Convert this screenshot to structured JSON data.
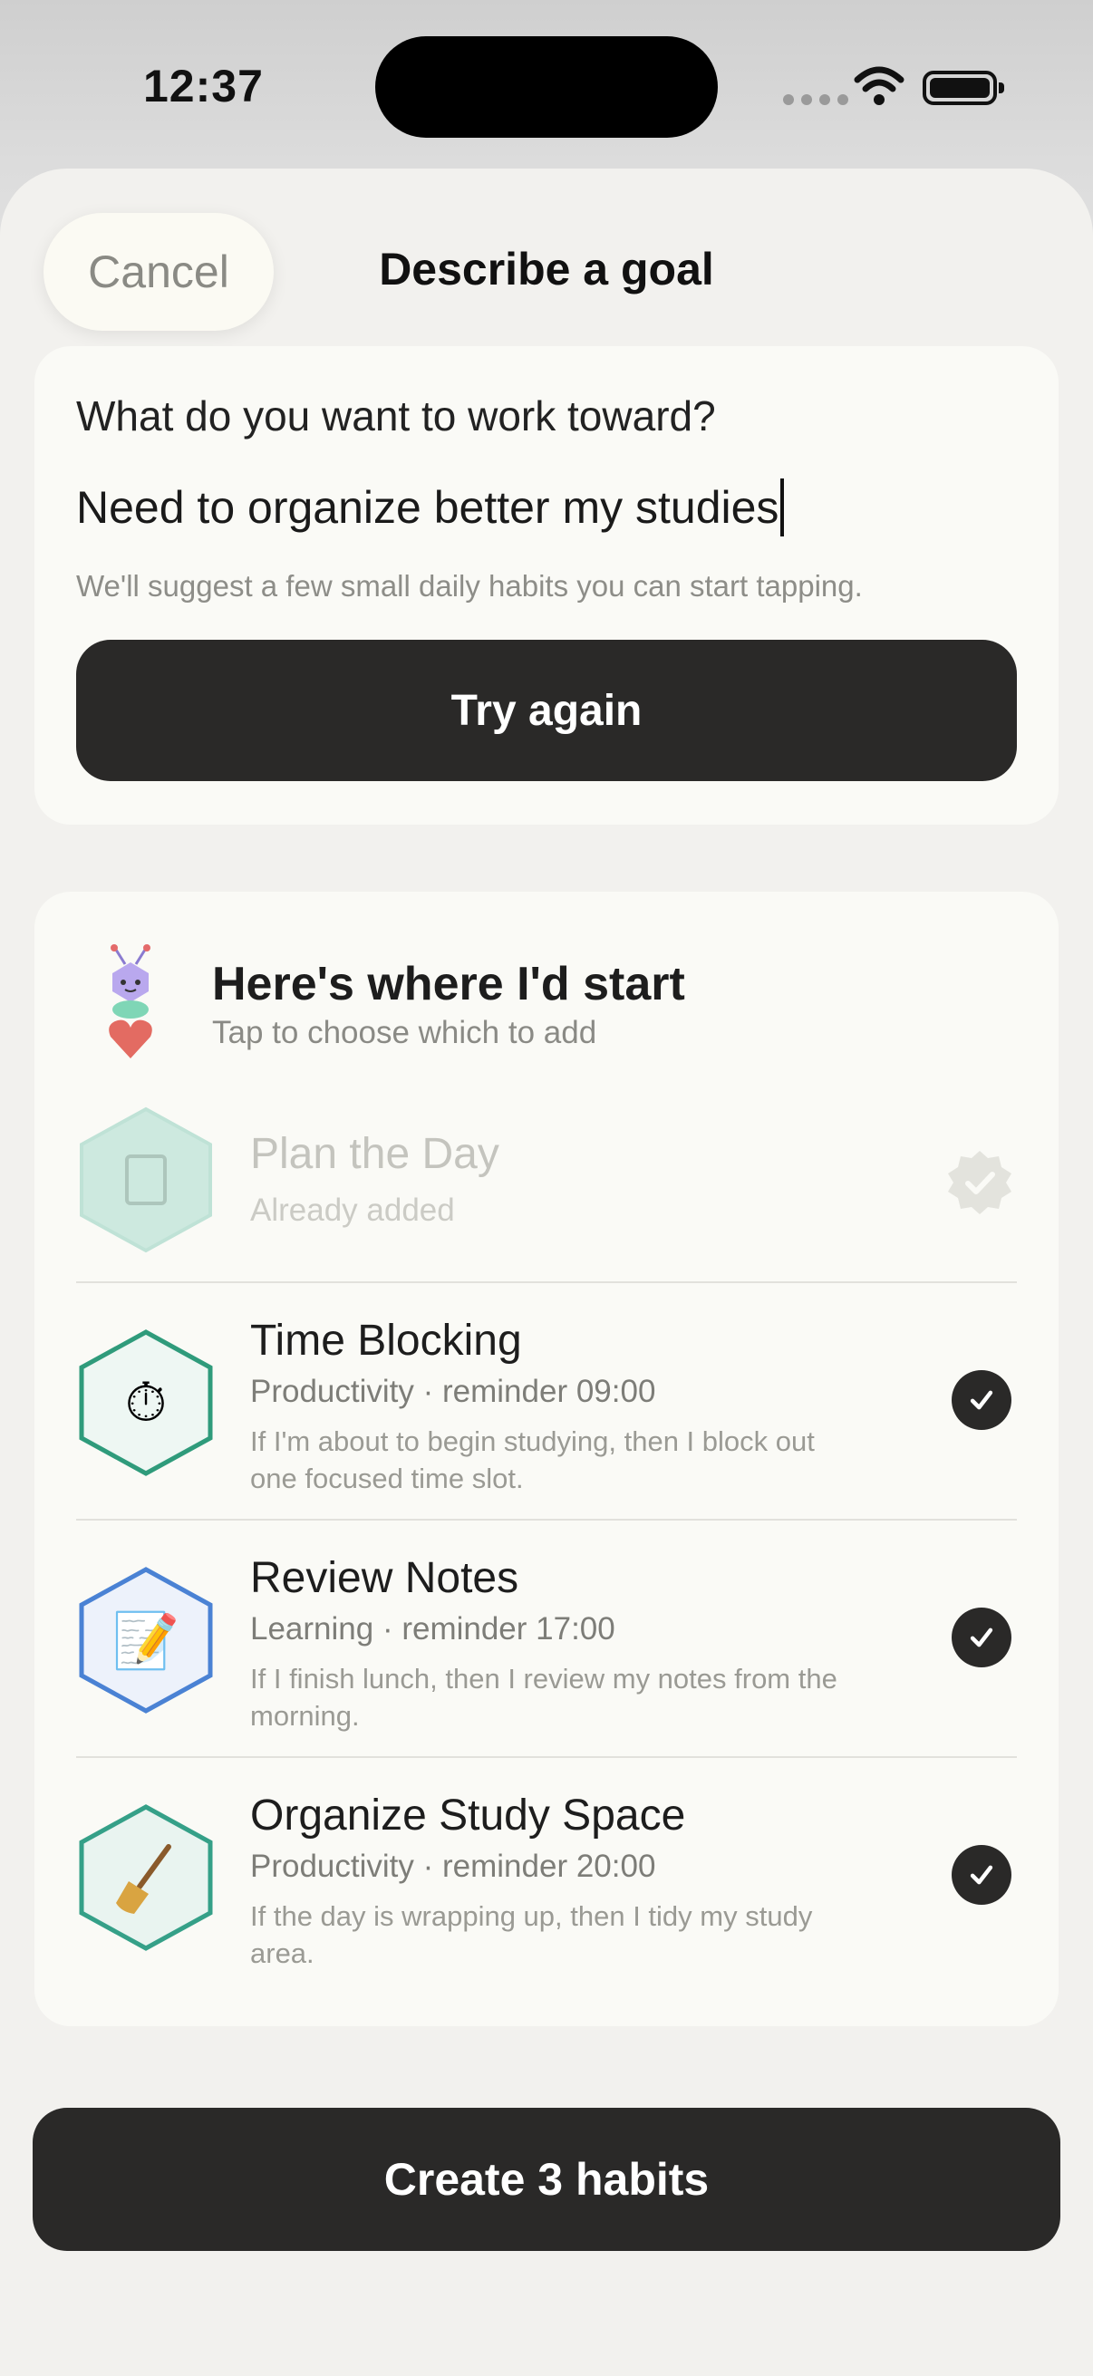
{
  "status_bar": {
    "time": "12:37"
  },
  "header": {
    "cancel_label": "Cancel",
    "title": "Describe a goal"
  },
  "goal": {
    "prompt": "What do you want to work toward?",
    "input_value": "Need to organize better my studies",
    "hint": "We'll suggest a few small daily habits you can start tapping.",
    "try_again_label": "Try again"
  },
  "suggestions": {
    "title": "Here's where I'd start",
    "subtitle": "Tap to choose which to add",
    "items": [
      {
        "name": "Plan the Day",
        "meta": "Already added",
        "desc": "",
        "icon": "notepad-icon",
        "status": "added",
        "color": "#7ccfb5"
      },
      {
        "name": "Time Blocking",
        "meta": "Productivity · reminder 09:00",
        "desc": "If I'm about to begin studying, then I block out one focused time slot.",
        "icon": "stopwatch-icon",
        "status": "selected",
        "color": "#2f9b7b"
      },
      {
        "name": "Review Notes",
        "meta": "Learning · reminder 17:00",
        "desc": "If I finish lunch, then I review my notes from the morning.",
        "icon": "memo-icon",
        "status": "selected",
        "color": "#4a82d4"
      },
      {
        "name": "Organize Study Space",
        "meta": "Productivity · reminder 20:00",
        "desc": "If the day is wrapping up, then I tidy my study area.",
        "icon": "broom-icon",
        "status": "selected",
        "color": "#35a088"
      }
    ]
  },
  "footer": {
    "create_label": "Create 3 habits"
  },
  "colors": {
    "dark_button": "#2a2928",
    "sheet": "#f2f1ee",
    "card": "#fafaf6"
  }
}
